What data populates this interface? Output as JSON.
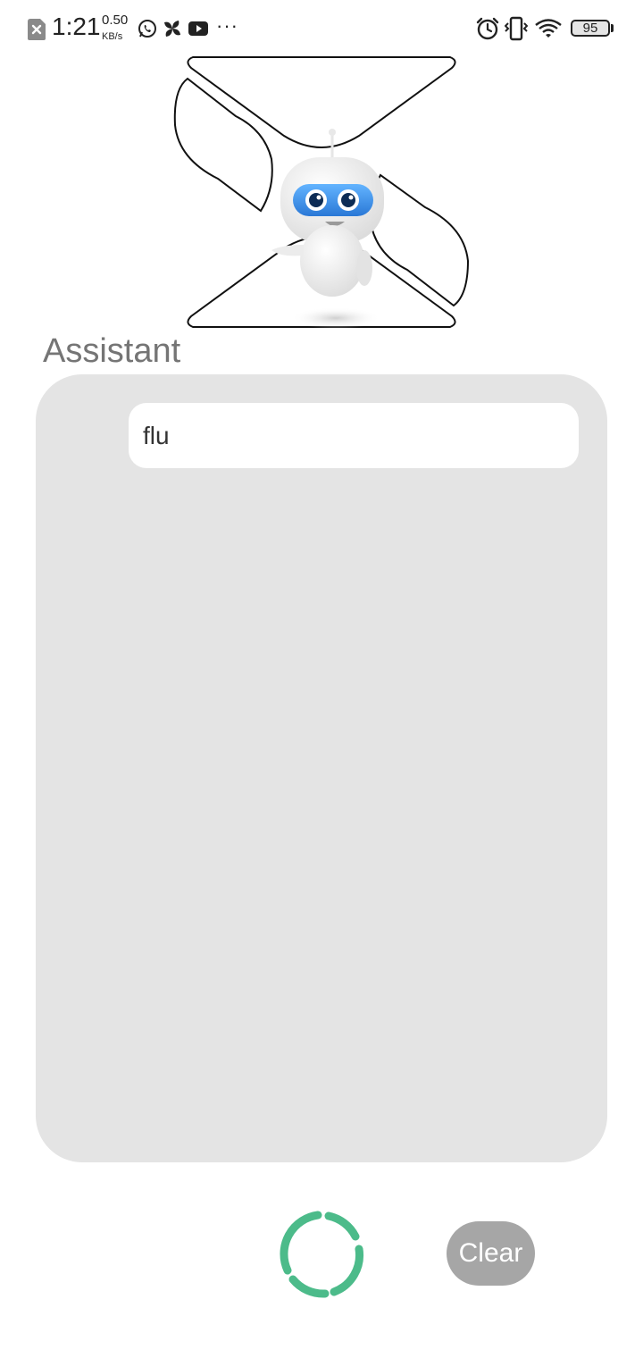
{
  "status_bar": {
    "time": "1:21",
    "net_speed_value": "0.50",
    "net_speed_unit": "KB/s",
    "notification_icons": [
      "blocked-notification-icon",
      "whatsapp-icon",
      "pinwheel-app-icon",
      "youtube-icon",
      "more-dots-icon"
    ],
    "system_icons": [
      "alarm-icon",
      "vibrate-icon",
      "wifi-icon",
      "battery-icon"
    ],
    "battery_level": "95",
    "more_indicator": "···"
  },
  "header": {
    "title": "Assistant"
  },
  "chat": {
    "messages": [
      {
        "text": "flu"
      }
    ]
  },
  "controls": {
    "clear_label": "Clear",
    "spinner_color": "#4cbb8a"
  },
  "colors": {
    "panel_bg": "#e4e4e4",
    "clear_bg": "#a6a6a6",
    "title_color": "#757575",
    "robot_visor": "#3a8fe0"
  }
}
